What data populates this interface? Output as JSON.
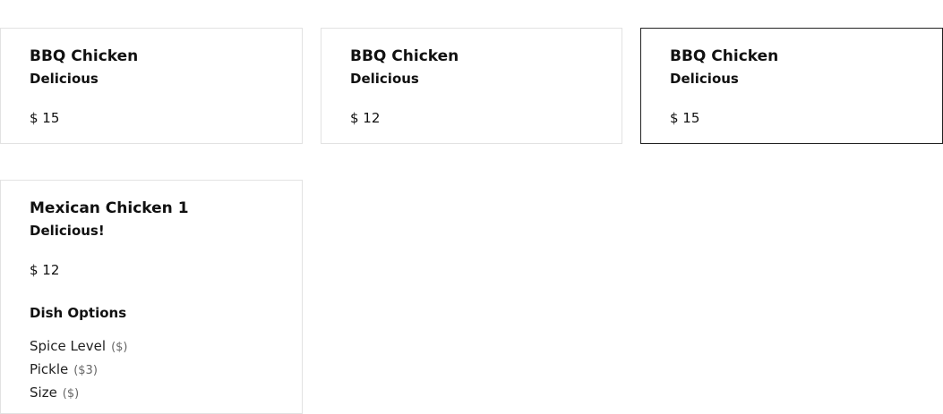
{
  "dishes": [
    {
      "name": "BBQ Chicken",
      "description": "Delicious",
      "price": "$ 15",
      "selected": false
    },
    {
      "name": "BBQ Chicken",
      "description": "Delicious",
      "price": "$ 12",
      "selected": false
    },
    {
      "name": "BBQ Chicken",
      "description": "Delicious",
      "price": "$ 15",
      "selected": true
    },
    {
      "name": "Mexican Chicken 1",
      "description": "Delicious!",
      "price": "$ 12",
      "selected": false,
      "options_heading": "Dish Options",
      "options": [
        {
          "label": "Spice Level",
          "extra": "($)"
        },
        {
          "label": "Pickle",
          "extra": "($3)"
        },
        {
          "label": "Size",
          "extra": "($)"
        }
      ]
    }
  ],
  "colors": {
    "card_border": "#e2e2e2",
    "selected_border": "#222222",
    "text": "#111111",
    "muted_text": "#666666"
  }
}
